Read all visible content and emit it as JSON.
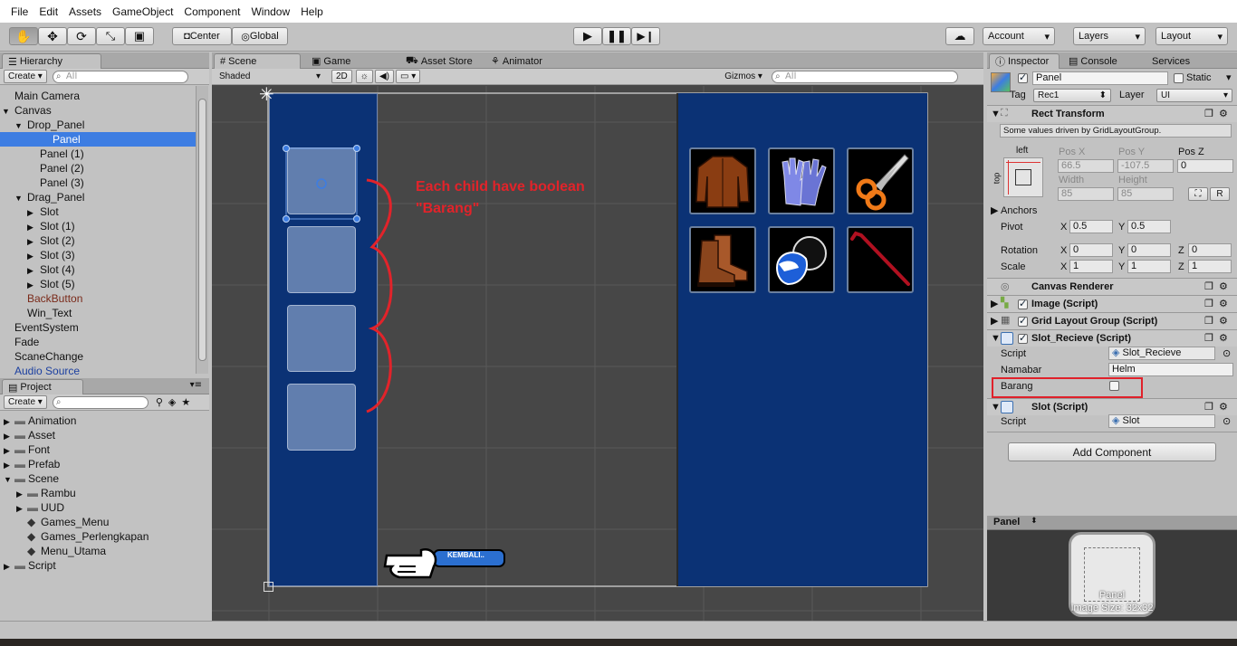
{
  "menu": [
    "File",
    "Edit",
    "Assets",
    "GameObject",
    "Component",
    "Window",
    "Help"
  ],
  "toolbar": {
    "pivot": "Center",
    "space": "Global",
    "account": "Account",
    "layers": "Layers",
    "layout": "Layout"
  },
  "hierarchy": {
    "tab": "Hierarchy",
    "create": "Create",
    "search": "All",
    "items": [
      {
        "label": "Main Camera",
        "indent": 0,
        "arrow": "",
        "selected": false,
        "color": ""
      },
      {
        "label": "Canvas",
        "indent": 0,
        "arrow": "▼",
        "selected": false,
        "color": ""
      },
      {
        "label": "Drop_Panel",
        "indent": 1,
        "arrow": "▼",
        "selected": false,
        "color": ""
      },
      {
        "label": "Panel",
        "indent": 2,
        "arrow": "",
        "selected": true,
        "color": ""
      },
      {
        "label": "Panel (1)",
        "indent": 2,
        "arrow": "",
        "selected": false,
        "color": ""
      },
      {
        "label": "Panel (2)",
        "indent": 2,
        "arrow": "",
        "selected": false,
        "color": ""
      },
      {
        "label": "Panel (3)",
        "indent": 2,
        "arrow": "",
        "selected": false,
        "color": ""
      },
      {
        "label": "Drag_Panel",
        "indent": 1,
        "arrow": "▼",
        "selected": false,
        "color": ""
      },
      {
        "label": "Slot",
        "indent": 2,
        "arrow": "▶",
        "selected": false,
        "color": ""
      },
      {
        "label": "Slot (1)",
        "indent": 2,
        "arrow": "▶",
        "selected": false,
        "color": ""
      },
      {
        "label": "Slot (2)",
        "indent": 2,
        "arrow": "▶",
        "selected": false,
        "color": ""
      },
      {
        "label": "Slot (3)",
        "indent": 2,
        "arrow": "▶",
        "selected": false,
        "color": ""
      },
      {
        "label": "Slot (4)",
        "indent": 2,
        "arrow": "▶",
        "selected": false,
        "color": ""
      },
      {
        "label": "Slot (5)",
        "indent": 2,
        "arrow": "▶",
        "selected": false,
        "color": ""
      },
      {
        "label": "BackButton",
        "indent": 1,
        "arrow": "",
        "selected": false,
        "color": "#7a2a1a"
      },
      {
        "label": "Win_Text",
        "indent": 1,
        "arrow": "",
        "selected": false,
        "color": ""
      },
      {
        "label": "EventSystem",
        "indent": 0,
        "arrow": "",
        "selected": false,
        "color": ""
      },
      {
        "label": "Fade",
        "indent": 0,
        "arrow": "",
        "selected": false,
        "color": ""
      },
      {
        "label": "ScaneChange",
        "indent": 0,
        "arrow": "",
        "selected": false,
        "color": ""
      },
      {
        "label": "Audio Source",
        "indent": 0,
        "arrow": "",
        "selected": false,
        "color": "#1b3fa0"
      }
    ]
  },
  "project": {
    "tab": "Project",
    "create": "Create",
    "items": [
      {
        "label": "Animation",
        "indent": 0,
        "arrow": "▶",
        "type": "folder"
      },
      {
        "label": "Asset",
        "indent": 0,
        "arrow": "▶",
        "type": "folder"
      },
      {
        "label": "Font",
        "indent": 0,
        "arrow": "▶",
        "type": "folder"
      },
      {
        "label": "Prefab",
        "indent": 0,
        "arrow": "▶",
        "type": "folder"
      },
      {
        "label": "Scene",
        "indent": 0,
        "arrow": "▼",
        "type": "folder"
      },
      {
        "label": "Rambu",
        "indent": 1,
        "arrow": "▶",
        "type": "folder"
      },
      {
        "label": "UUD",
        "indent": 1,
        "arrow": "▶",
        "type": "folder"
      },
      {
        "label": "Games_Menu",
        "indent": 1,
        "arrow": "",
        "type": "scene"
      },
      {
        "label": "Games_Perlengkapan",
        "indent": 1,
        "arrow": "",
        "type": "scene"
      },
      {
        "label": "Menu_Utama",
        "indent": 1,
        "arrow": "",
        "type": "scene"
      },
      {
        "label": "Script",
        "indent": 0,
        "arrow": "▶",
        "type": "folder"
      }
    ]
  },
  "scene": {
    "tabs": [
      "Scene",
      "Game",
      "Asset Store",
      "Animator"
    ],
    "shading": "Shaded",
    "mode2d": "2D",
    "gizmos": "Gizmos",
    "search": "All",
    "annotation_line1": "Each child have boolean",
    "annotation_line2": "\"Barang\"",
    "back_label": "KEMBALI..",
    "items": [
      "jacket",
      "gloves",
      "scissors",
      "boots",
      "helmet",
      "crowbar"
    ]
  },
  "inspector": {
    "tabs": [
      "Inspector",
      "Console",
      "Services"
    ],
    "object_name": "Panel",
    "static_label": "Static",
    "tag_label": "Tag",
    "tag_value": "Rec1",
    "layer_label": "Layer",
    "layer_value": "UI",
    "rect_title": "Rect Transform",
    "driven_note": "Some values driven by GridLayoutGroup.",
    "anchor_left": "left",
    "anchor_top": "top",
    "posx_label": "Pos X",
    "posy_label": "Pos Y",
    "posz_label": "Pos Z",
    "posx": "66.5",
    "posy": "-107.5",
    "posz": "0",
    "width_label": "Width",
    "height_label": "Height",
    "width": "85",
    "height": "85",
    "r_button": "R",
    "anchors_label": "Anchors",
    "pivot_label": "Pivot",
    "pivot_x": "0.5",
    "pivot_y": "0.5",
    "rotation_label": "Rotation",
    "rot_x": "0",
    "rot_y": "0",
    "rot_z": "0",
    "scale_label": "Scale",
    "scale_x": "1",
    "scale_y": "1",
    "scale_z": "1",
    "x": "X",
    "y": "Y",
    "z": "Z",
    "canvas_renderer": "Canvas Renderer",
    "image_script": "Image (Script)",
    "grid_script": "Grid Layout Group (Script)",
    "slot_recieve": "Slot_Recieve (Script)",
    "script_label": "Script",
    "script_value": "Slot_Recieve",
    "namabar_label": "Namabar",
    "namabar_value": "Helm",
    "barang_label": "Barang",
    "slot_script": "Slot (Script)",
    "slot_script_value": "Slot",
    "add_component": "Add Component",
    "preview_title": "Panel",
    "preview_name": "Panel",
    "preview_size": "Image Size: 32x32"
  },
  "colors": {
    "canvas_blue": "#0b3275",
    "selection": "#3d7de2",
    "annotation": "#e2232a",
    "highlight_box": "#e0212a"
  }
}
